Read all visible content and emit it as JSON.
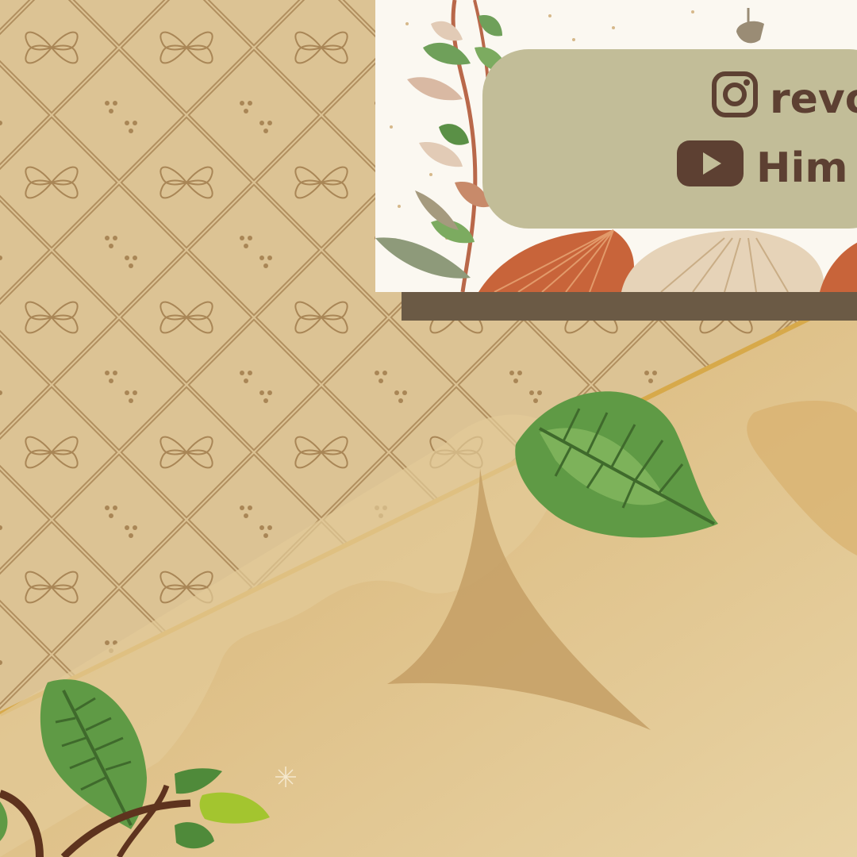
{
  "social": {
    "instagram": {
      "icon": "instagram-icon",
      "text": "revo"
    },
    "youtube": {
      "icon": "youtube-icon",
      "text": "Him"
    }
  },
  "colors": {
    "pattern_bg": "#dcc394",
    "pattern_line": "#a98656",
    "lower_bg": "#d9b77a",
    "card_bg": "#fbf8f1",
    "pill_bg": "#c2bd98",
    "text_brown": "#5d4032",
    "leaf_green": "#5f9a45",
    "gold_line": "#d7a94a"
  }
}
